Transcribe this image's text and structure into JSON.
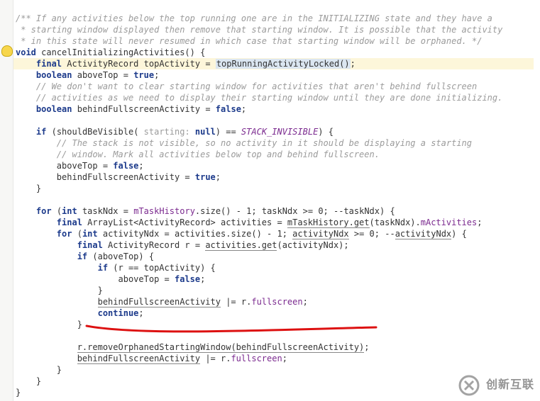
{
  "code": {
    "c1": "/** If any activities below the top running one are in the INITIALIZING state and they have a",
    "c2": " * starting window displayed then remove that starting window. It is possible that the activity",
    "c3": " * in this state will never resumed in which case that starting window will be orphaned. */",
    "kw_void": "void",
    "fn_name": "cancelInitializingActivities() {",
    "kw_final": "final",
    "type_ar": "ActivityRecord",
    "var_top": "topActivity = ",
    "call_top": "topRunningActivityLocked()",
    "semi": ";",
    "kw_boolean": "boolean",
    "var_above": "aboveTop = ",
    "kw_true": "true",
    "c4": "// We don't want to clear starting window for activities that aren't behind fullscreen",
    "c5": "// activities as we need to display their starting window until they are done initializing.",
    "var_behind_decl": "behindFullscreenActivity = ",
    "kw_false": "false",
    "kw_if": "if",
    "call_vis": "(shouldBeVisible( ",
    "hint_starting": "starting: ",
    "kw_null": "null",
    "paren_eq": ") == ",
    "const_invisible": "STACK_INVISIBLE",
    "rparen_brace": ") {",
    "c6": "// The stack is not visible, so no activity in it should be displaying a starting",
    "c7": "// window. Mark all activities below top and behind fullscreen.",
    "stmt_above_false": "aboveTop = ",
    "stmt_behind_true": "behindFullscreenActivity = ",
    "rbrace": "}",
    "kw_for": "for",
    "for1_open": " (",
    "kw_int": "int",
    "for1_init": " taskNdx = ",
    "fld_history": "mTaskHistory",
    "for1_size": ".size() - 1; taskNdx >= 0; --taskNdx) {",
    "for1_line2a": " ArrayList<ActivityRecord> activities = ",
    "for1_line2b_u": "mTaskHistory.get",
    "for1_line2c": "(taskNdx).",
    "fld_acts": "mActivities",
    "for2_init": " activityNdx = activities.size() - 1; ",
    "for2_cond_u": "activityNdx",
    "for2_rest": " >= 0; --",
    "for2_rest2_u": "activityNdx",
    "for2_end": ") {",
    "line_r_a": " ActivityRecord r = ",
    "line_r_b_u": "activities.get",
    "line_r_c": "(activityNdx);",
    "if_above": " (aboveTop) {",
    "if_req": " (r == topActivity) {",
    "stmt_afalse": "aboveTop = ",
    "behind_or1_u": "behindFullscreenActivity",
    "behind_or1_b": " |= r.",
    "fld_full": "fullscreen",
    "kw_continue": "continue",
    "call_remove_u": "r.removeOrphanedStartingWindow(behindFullscreenActivity)",
    "behind_or2_u": "behindFullscreenActivity",
    "behind_or2_b": " |= r."
  },
  "watermark": {
    "text": "创新互联"
  }
}
